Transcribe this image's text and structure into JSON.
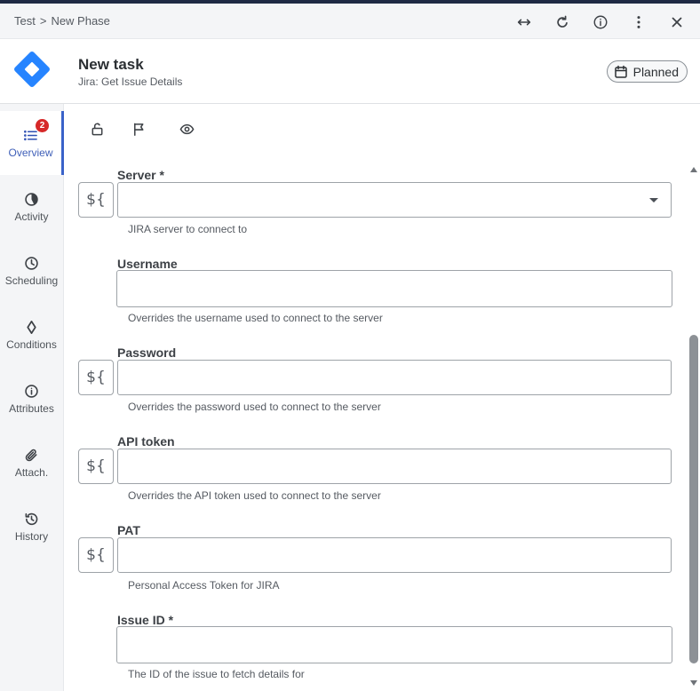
{
  "topbar": {
    "breadcrumb": [
      "Test",
      "New Phase"
    ],
    "separator": ">",
    "actions": [
      {
        "name": "expand-button",
        "icon": "horizontal-arrows-icon"
      },
      {
        "name": "refresh-button",
        "icon": "refresh-icon"
      },
      {
        "name": "info-button",
        "icon": "info-icon"
      },
      {
        "name": "more-button",
        "icon": "vertical-dots-icon"
      },
      {
        "name": "close-button",
        "icon": "close-icon"
      }
    ]
  },
  "header": {
    "title": "New task",
    "subtitle": "Jira: Get Issue Details",
    "status": "Planned",
    "logo_color": "#2684ff"
  },
  "sidebar": {
    "items": [
      {
        "label": "Overview",
        "icon": "list-icon",
        "badge": "2",
        "active": true
      },
      {
        "label": "Activity",
        "icon": "pie-icon"
      },
      {
        "label": "Scheduling",
        "icon": "clock-icon"
      },
      {
        "label": "Conditions",
        "icon": "diamond-icon"
      },
      {
        "label": "Attributes",
        "icon": "info-icon"
      },
      {
        "label": "Attach.",
        "icon": "paperclip-icon"
      },
      {
        "label": "History",
        "icon": "history-icon"
      }
    ]
  },
  "toolstrip": {
    "icons": [
      "unlock-icon",
      "flag-icon",
      "eye-icon"
    ]
  },
  "form": {
    "var_button": "${",
    "fields": [
      {
        "label": "Server *",
        "hint": "JIRA server to connect to",
        "value": "",
        "has_var": true,
        "type": "select"
      },
      {
        "label": "Username",
        "hint": "Overrides the username used to connect to the server",
        "value": "",
        "has_var": false,
        "type": "text"
      },
      {
        "label": "Password",
        "hint": "Overrides the password used to connect to the server",
        "value": "",
        "has_var": true,
        "type": "password"
      },
      {
        "label": "API token",
        "hint": "Overrides the API token used to connect to the server",
        "value": "",
        "has_var": true,
        "type": "password"
      },
      {
        "label": "PAT",
        "hint": "Personal Access Token for JIRA",
        "value": "",
        "has_var": true,
        "type": "password"
      },
      {
        "label": "Issue ID *",
        "hint": "The ID of the issue to fetch details for",
        "value": "",
        "has_var": false,
        "type": "text"
      }
    ]
  },
  "colors": {
    "accent": "#3a62c9",
    "badge": "#d62828",
    "topstrip": "#1f2a44"
  }
}
